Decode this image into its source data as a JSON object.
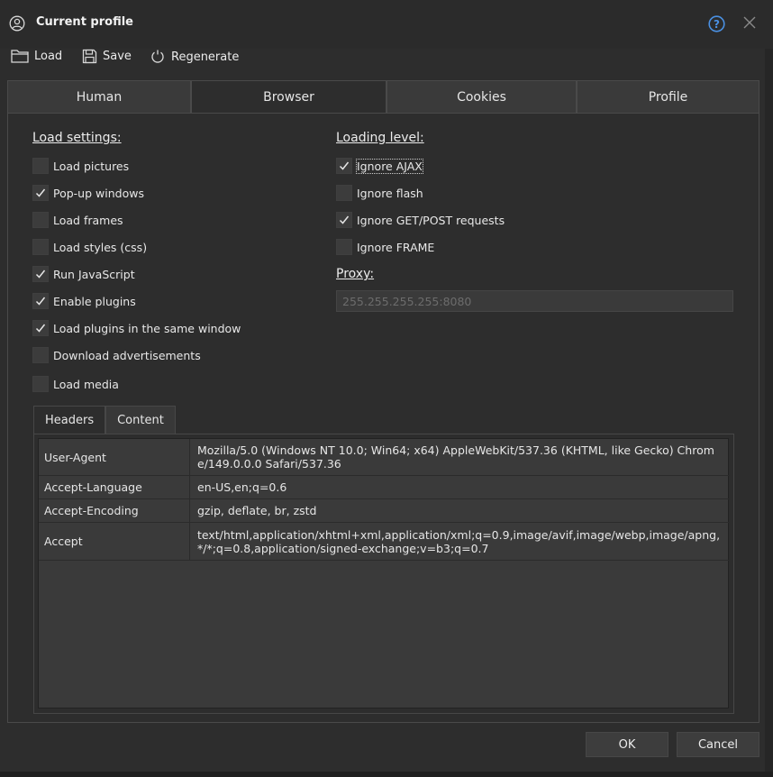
{
  "window": {
    "title": "Current profile",
    "icons": {
      "user": "user-circle-icon",
      "help": "help-circle-icon",
      "close": "close-icon"
    },
    "accent": "#4a90e2"
  },
  "toolbar": {
    "load_label": "Load",
    "save_label": "Save",
    "regenerate_label": "Regenerate"
  },
  "tabs": [
    {
      "label": "Human",
      "active": false
    },
    {
      "label": "Browser",
      "active": true
    },
    {
      "label": "Cookies",
      "active": false
    },
    {
      "label": "Profile",
      "active": false
    }
  ],
  "load_settings": {
    "heading": "Load settings:",
    "items": [
      {
        "label": "Load pictures",
        "checked": false
      },
      {
        "label": "Pop-up windows",
        "checked": true
      },
      {
        "label": "Load frames",
        "checked": false
      },
      {
        "label": "Load styles (css)",
        "checked": false
      },
      {
        "label": "Run JavaScript",
        "checked": true
      },
      {
        "label": "Enable plugins",
        "checked": true
      },
      {
        "label": "Load plugins in the same window",
        "checked": true
      },
      {
        "label": "Download advertisements",
        "checked": false
      },
      {
        "label": "Load media",
        "checked": false
      }
    ]
  },
  "loading_level": {
    "heading": "Loading level:",
    "items": [
      {
        "label": "Ignore AJAX",
        "checked": true
      },
      {
        "label": "Ignore flash",
        "checked": false
      },
      {
        "label": "Ignore GET/POST requests",
        "checked": true
      },
      {
        "label": "Ignore FRAME",
        "checked": false
      }
    ]
  },
  "proxy": {
    "heading": "Proxy:",
    "placeholder": "255.255.255.255:8080",
    "value": ""
  },
  "subtabs": [
    {
      "label": "Headers",
      "active": true
    },
    {
      "label": "Content",
      "active": false
    }
  ],
  "headers": [
    {
      "key": "User-Agent",
      "value": "Mozilla/5.0 (Windows NT 10.0; Win64; x64) AppleWebKit/537.36 (KHTML, like Gecko) Chrome/149.0.0.0 Safari/537.36"
    },
    {
      "key": "Accept-Language",
      "value": "en-US,en;q=0.6"
    },
    {
      "key": "Accept-Encoding",
      "value": "gzip, deflate, br, zstd"
    },
    {
      "key": "Accept",
      "value": "text/html,application/xhtml+xml,application/xml;q=0.9,image/avif,image/webp,image/apng,*/*;q=0.8,application/signed-exchange;v=b3;q=0.7"
    }
  ],
  "buttons": {
    "ok_label": "OK",
    "cancel_label": "Cancel"
  }
}
